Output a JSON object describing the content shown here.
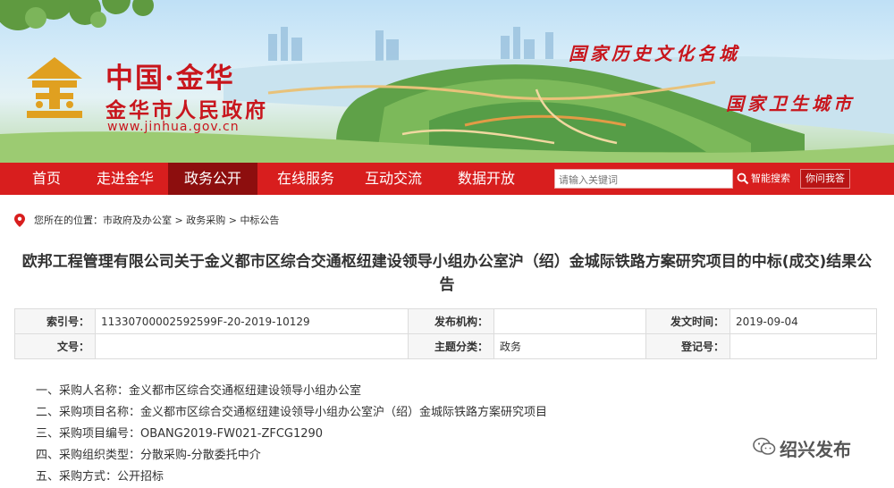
{
  "header": {
    "logo_char": "金",
    "site_name": "中国·金华",
    "site_subtitle": "金华市人民政府",
    "site_url": "www.jinhua.gov.cn",
    "slogan_1": "国家历史文化名城",
    "slogan_2": "国家卫生城市"
  },
  "nav": {
    "items": [
      {
        "label": "首页"
      },
      {
        "label": "走进金华"
      },
      {
        "label": "政务公开"
      },
      {
        "label": "在线服务"
      },
      {
        "label": "互动交流"
      },
      {
        "label": "数据开放"
      }
    ],
    "active_index": 2,
    "search_placeholder": "请输入关键词",
    "smart_search_label": "智能搜索",
    "ask_label": "你问我答"
  },
  "breadcrumb": {
    "prefix": "您所在的位置：",
    "items": [
      "市政府及办公室",
      "政务采购",
      "中标公告"
    ],
    "separator": " > "
  },
  "article": {
    "title": "欧邦工程管理有限公司关于金义都市区综合交通枢纽建设领导小组办公室沪（绍）金城际铁路方案研究项目的中标(成交)结果公告"
  },
  "meta": {
    "index_label": "索引号：",
    "index_value": "11330700002592599F-20-2019-10129",
    "publisher_label": "发布机构：",
    "publisher_value": "",
    "date_label": "发文时间：",
    "date_value": "2019-09-04",
    "doc_no_label": "文号：",
    "doc_no_value": "",
    "category_label": "主题分类：",
    "category_value": "政务",
    "reg_no_label": "登记号：",
    "reg_no_value": ""
  },
  "content": {
    "lines": [
      "一、采购人名称：金义都市区综合交通枢纽建设领导小组办公室",
      "二、采购项目名称：金义都市区综合交通枢纽建设领导小组办公室沪（绍）金城际铁路方案研究项目",
      "三、采购项目编号：OBANG2019-FW021-ZFCG1290",
      "四、采购组织类型：分散采购-分散委托中介",
      "五、采购方式：公开招标"
    ]
  },
  "watermark": {
    "text": "绍兴发布"
  },
  "colors": {
    "nav_red": "#d81e1e",
    "nav_active": "#8d0e0e",
    "brand_red": "#c8161d"
  }
}
